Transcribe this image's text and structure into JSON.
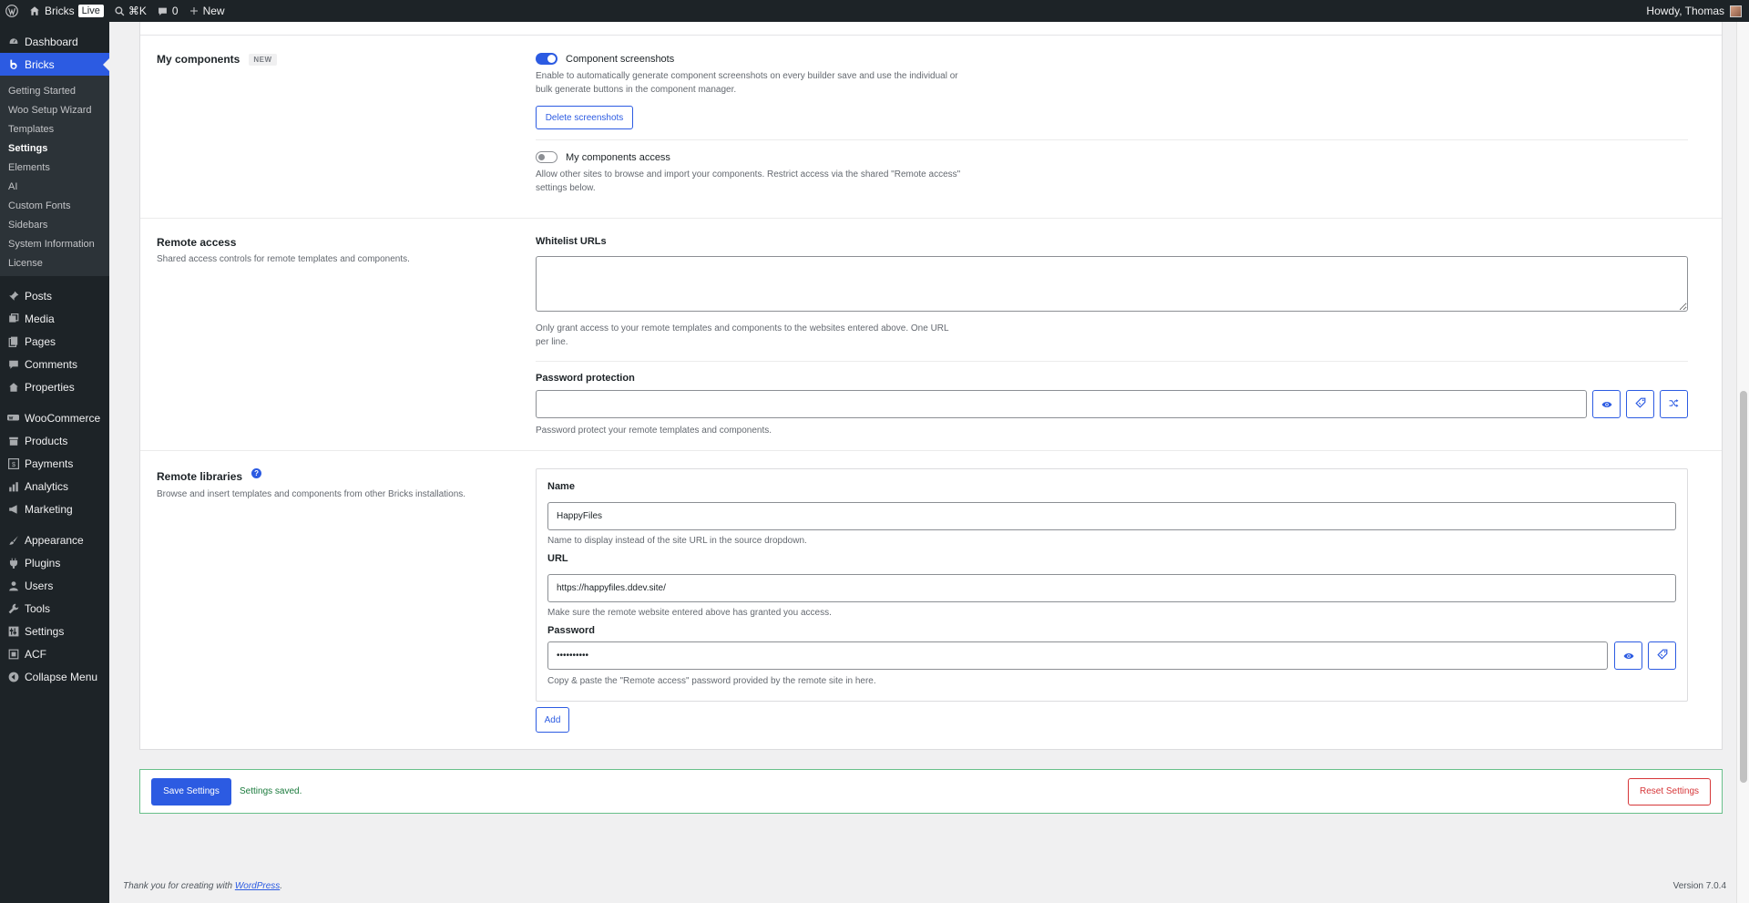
{
  "adminbar": {
    "site_name": "Bricks",
    "live_label": "Live",
    "search_shortcut": "⌘K",
    "comments_count": "0",
    "new_label": "New",
    "greeting": "Howdy, Thomas"
  },
  "sidebar": {
    "dashboard": "Dashboard",
    "bricks": "Bricks",
    "bricks_sub": [
      "Getting Started",
      "Woo Setup Wizard",
      "Templates",
      "Settings",
      "Elements",
      "AI",
      "Custom Fonts",
      "Sidebars",
      "System Information",
      "License"
    ],
    "posts": "Posts",
    "media": "Media",
    "pages": "Pages",
    "comments": "Comments",
    "properties": "Properties",
    "woocommerce": "WooCommerce",
    "products": "Products",
    "payments": "Payments",
    "analytics": "Analytics",
    "marketing": "Marketing",
    "appearance": "Appearance",
    "plugins": "Plugins",
    "users": "Users",
    "tools": "Tools",
    "settings": "Settings",
    "acf": "ACF",
    "collapse": "Collapse Menu"
  },
  "my_components": {
    "title": "My components",
    "badge": "NEW",
    "screenshots_label": "Component screenshots",
    "screenshots_desc_1": "Enable to automatically generate component screenshots on every builder save and use the individual or",
    "screenshots_desc_2": "bulk generate buttons in the component manager.",
    "delete_button": "Delete screenshots",
    "access_label": "My components access",
    "access_desc_1": "Allow other sites to browse and import your components. Restrict access via the shared \"Remote access\"",
    "access_desc_2": "settings below."
  },
  "remote_access": {
    "title": "Remote access",
    "desc": "Shared access controls for remote templates and components.",
    "whitelist_label": "Whitelist URLs",
    "whitelist_value": "",
    "whitelist_desc_1": "Only grant access to your remote templates and components to the websites entered above. One URL",
    "whitelist_desc_2": "per line.",
    "password_label": "Password protection",
    "password_value": "",
    "password_desc": "Password protect your remote templates and components."
  },
  "remote_libraries": {
    "title": "Remote libraries",
    "help": "?",
    "desc": "Browse and insert templates and components from other Bricks installations.",
    "name_label": "Name",
    "name_value": "HappyFiles",
    "name_desc": "Name to display instead of the site URL in the source dropdown.",
    "url_label": "URL",
    "url_value": "https://happyfiles.ddev.site/",
    "url_desc": "Make sure the remote website entered above has granted you access.",
    "password_label": "Password",
    "password_value": "••••••••••",
    "password_desc": "Copy & paste the \"Remote access\" password provided by the remote site in here.",
    "add_button": "Add"
  },
  "save_bar": {
    "save_button": "Save Settings",
    "message": "Settings saved.",
    "reset_button": "Reset Settings"
  },
  "footer": {
    "thanks_prefix": "Thank you for creating with ",
    "wordpress_link": "WordPress",
    "thanks_suffix": ".",
    "version": "Version 7.0.4"
  },
  "colors": {
    "accent": "#2c5be2",
    "admin_dark": "#1d2327",
    "success_border": "#68c08a",
    "danger": "#d63638"
  }
}
